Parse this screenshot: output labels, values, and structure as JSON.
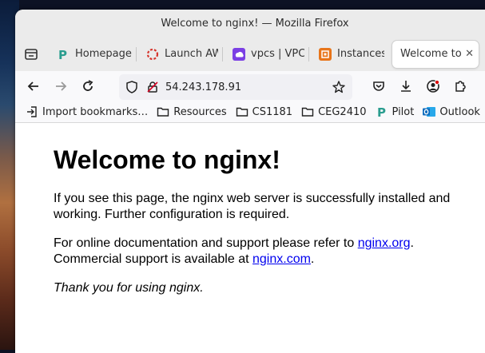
{
  "window": {
    "title": "Welcome to nginx! — Mozilla Firefox"
  },
  "tabs": [
    {
      "label": "Homepage",
      "icon": "pilot-p-icon",
      "active": false
    },
    {
      "label": "Launch AW",
      "icon": "aws-launch-icon",
      "active": false
    },
    {
      "label": "vpcs | VPC",
      "icon": "vpc-icon",
      "active": false
    },
    {
      "label": "Instances |",
      "icon": "ec2-instances-icon",
      "active": false
    },
    {
      "label": "Welcome to",
      "icon": "",
      "active": true
    }
  ],
  "navbar": {
    "url": "54.243.178.91"
  },
  "bookmarks": [
    {
      "label": "Import bookmarks…",
      "icon": "import-icon"
    },
    {
      "label": "Resources",
      "icon": "folder-icon"
    },
    {
      "label": "CS1181",
      "icon": "folder-icon"
    },
    {
      "label": "CEG2410",
      "icon": "folder-icon"
    },
    {
      "label": "Pilot",
      "icon": "pilot-p-icon"
    },
    {
      "label": "Outlook",
      "icon": "outlook-icon"
    }
  ],
  "page": {
    "heading": "Welcome to nginx!",
    "para1": "If you see this page, the nginx web server is successfully installed and working. Further configuration is required.",
    "para2_prefix": "For online documentation and support please refer to ",
    "link1": "nginx.org",
    "para2_mid": ".",
    "para2_line2": "Commercial support is available at ",
    "link2": "nginx.com",
    "para2_end": ".",
    "para3": "Thank you for using nginx."
  },
  "colors": {
    "link": "#0000ee",
    "pilot_green": "#2a9d8f",
    "vpc_purple": "#7b3fe4",
    "ec2_orange": "#e8751a",
    "outlook_blue": "#0f6cbd"
  }
}
